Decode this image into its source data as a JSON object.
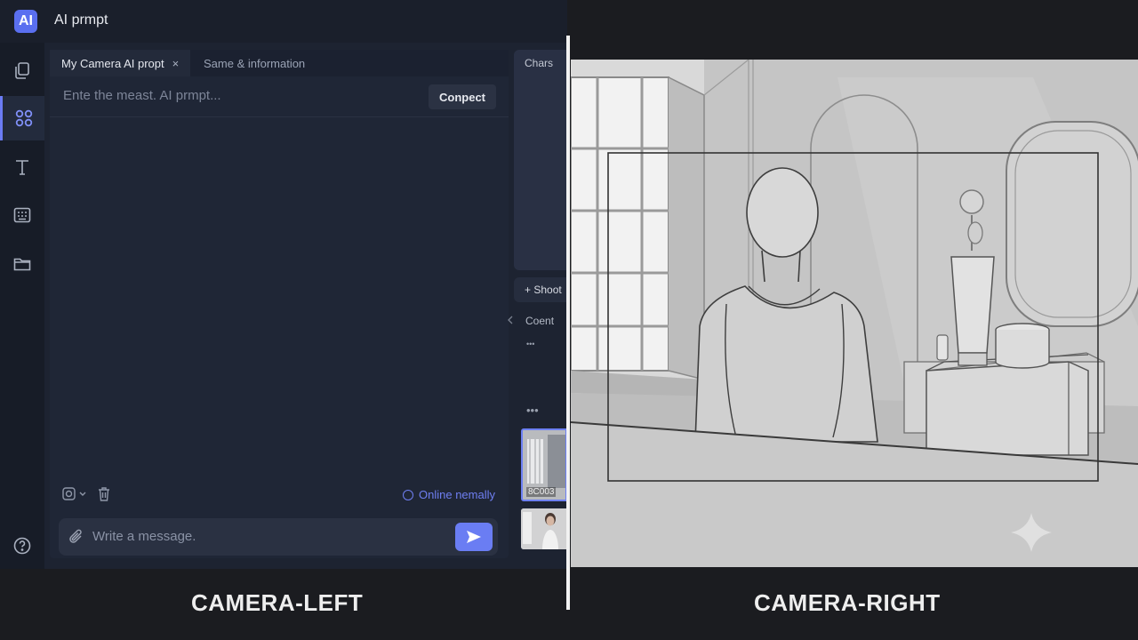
{
  "app": {
    "logo": "AI",
    "title": "AI prmpt"
  },
  "sidebar": {
    "items": [
      {
        "icon": "copy-icon"
      },
      {
        "icon": "grid-icon",
        "active": true
      },
      {
        "icon": "text-icon"
      },
      {
        "icon": "keyboard-icon"
      },
      {
        "icon": "folder-icon"
      },
      {
        "icon": "help-icon"
      }
    ]
  },
  "tabs": [
    {
      "label": "My Camera AI propt",
      "close": "×",
      "active": true
    },
    {
      "label": "Same & information",
      "active": false
    }
  ],
  "prompt": {
    "placeholder": "Ente the meast. AI prmpt...",
    "connect_label": "Conpect"
  },
  "status": {
    "online_label": "Online nemally"
  },
  "composer": {
    "placeholder": "Write a message.",
    "send_icon": "send-icon"
  },
  "right_panel": {
    "title": "Chars",
    "shoot_label": "+ Shoot",
    "section_label": "Coent",
    "more_top": "•••",
    "more": "•••",
    "thumb1_label": "8C003"
  },
  "captions": {
    "left": "CAMERA-LEFT",
    "right": "CAMERA-RIGHT"
  },
  "colors": {
    "accent": "#6a7df3",
    "app_bg": "#1d2331",
    "sketch_bg": "#c6c6c6"
  }
}
